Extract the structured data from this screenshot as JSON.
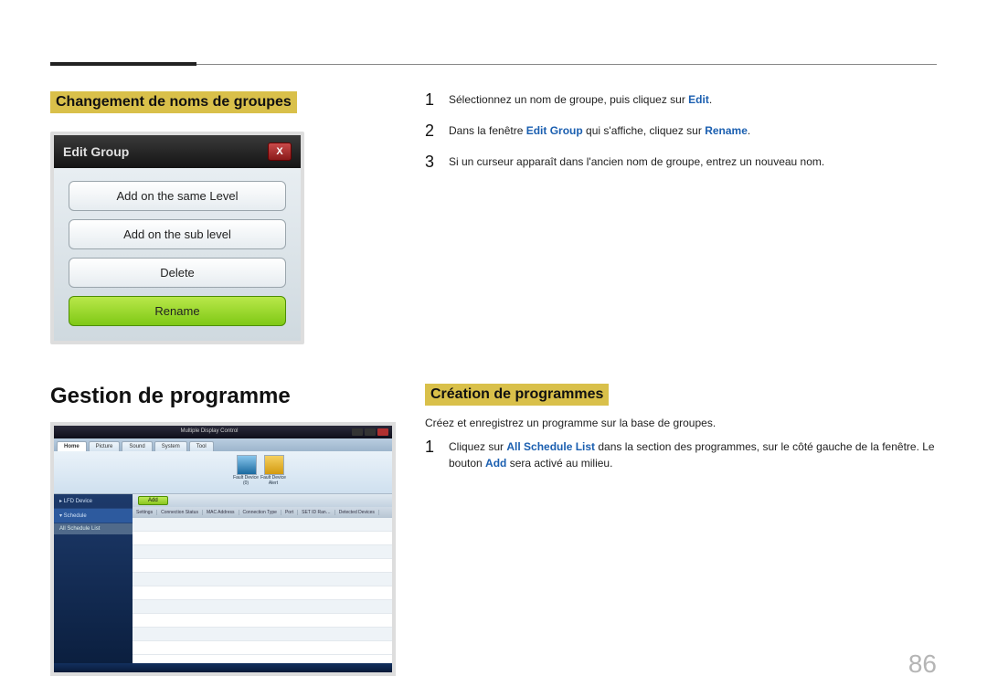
{
  "section1": {
    "heading": "Changement de noms de groupes",
    "dialog": {
      "title": "Edit Group",
      "close_glyph": "X",
      "btn_same": "Add on the same Level",
      "btn_sub": "Add on the sub level",
      "btn_delete": "Delete",
      "btn_rename": "Rename"
    },
    "steps": [
      {
        "num": "1",
        "pre": "Sélectionnez un nom de groupe, puis cliquez sur ",
        "kw": "Edit",
        "post": "."
      },
      {
        "num": "2",
        "pre": "Dans la fenêtre ",
        "kw": "Edit Group",
        "mid": " qui s'affiche, cliquez sur ",
        "kw2": "Rename",
        "post": "."
      },
      {
        "num": "3",
        "pre": "Si un curseur apparaît dans l'ancien nom de groupe, entrez un nouveau nom."
      }
    ]
  },
  "section2": {
    "main_heading": "Gestion de programme",
    "sub_heading": "Création de programmes",
    "intro": "Créez et enregistrez un programme sur la base de groupes.",
    "step": {
      "num": "1",
      "pre": "Cliquez sur ",
      "kw": "All Schedule List",
      "mid": " dans la section des programmes, sur le côté gauche de la fenêtre. Le bouton ",
      "kw2": "Add",
      "post": " sera activé au milieu."
    },
    "mdc": {
      "title": "Multiple Display Control",
      "tabs": [
        "Home",
        "Picture",
        "Sound",
        "System",
        "Tool"
      ],
      "ribbon_icons": [
        {
          "label": "Fault Device (0)"
        },
        {
          "label": "Fault Device Alert"
        }
      ],
      "sidebar": {
        "lfd": "▸ LFD Device",
        "schedule": "▾ Schedule",
        "all_list": "All Schedule List"
      },
      "add_label": "Add",
      "cols": [
        "Settings",
        "Connection Status",
        "MAC Address",
        "Connection Type",
        "Port",
        "SET ID Ran…",
        "Detected Devices"
      ]
    }
  },
  "page_number": "86"
}
